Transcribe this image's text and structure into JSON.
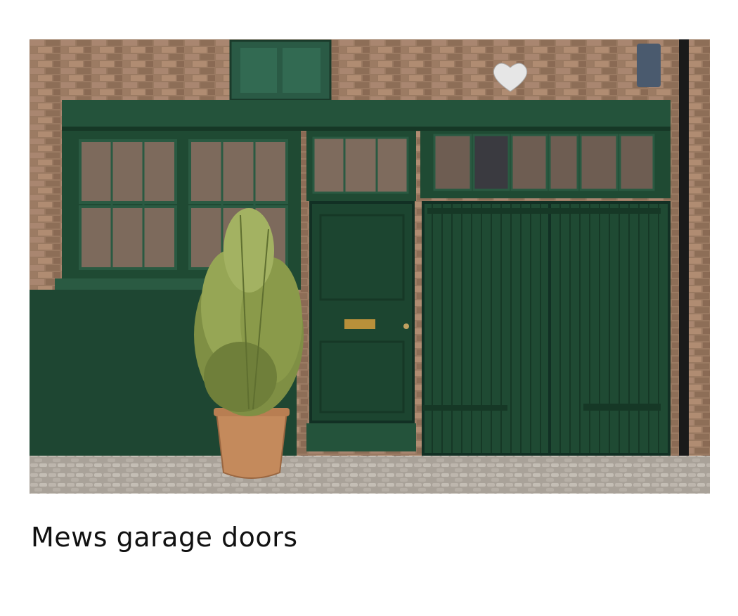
{
  "card": {
    "caption": "Mews garage doors"
  },
  "photo": {
    "subject": "mews-garage-facade",
    "colors": {
      "brick": "#9a7a62",
      "paint_green": "#1f4a33",
      "paint_green_dark": "#163826",
      "cobbles": "#b7b0a7",
      "pot": "#c48a5c",
      "foliage": "#8a9a4a"
    }
  }
}
